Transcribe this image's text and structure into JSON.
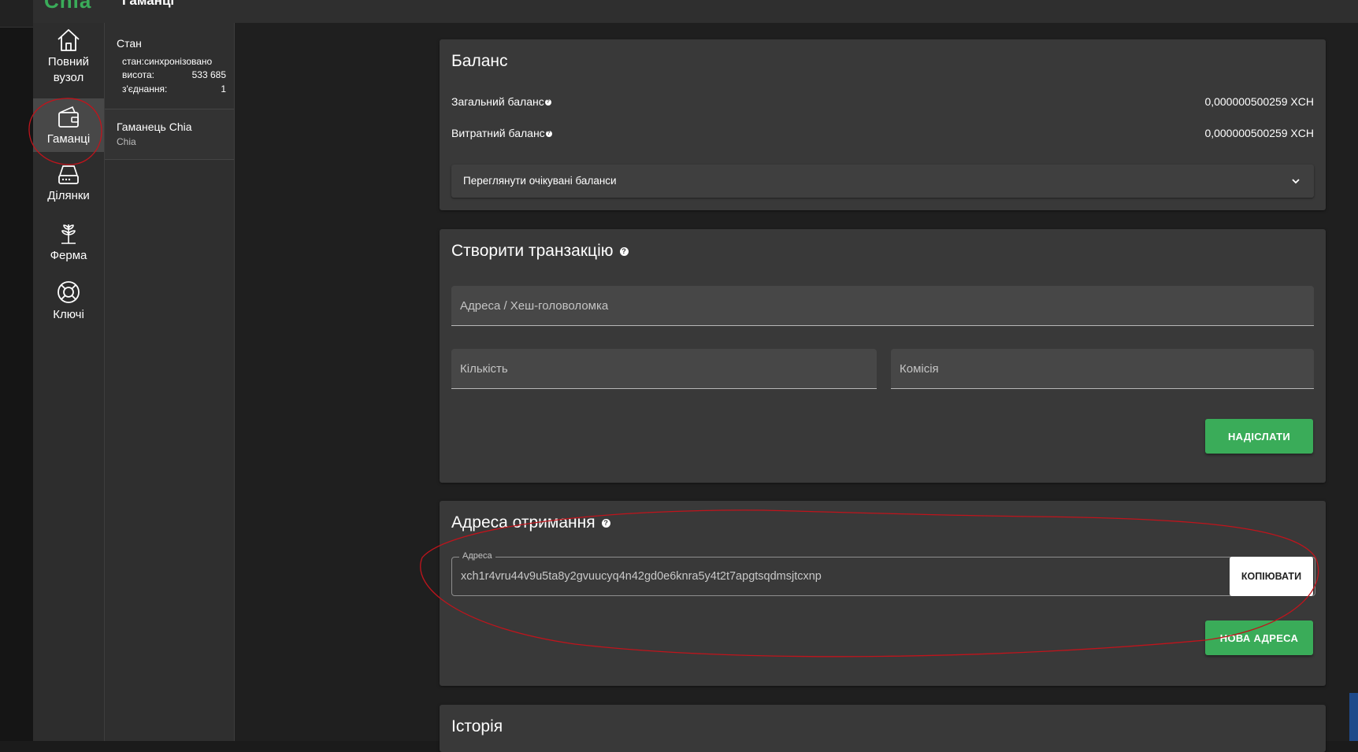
{
  "app": {
    "logo": "Chia",
    "page_title": "Гаманці"
  },
  "nav": {
    "items": [
      {
        "id": "full-node",
        "label_line1": "Повний",
        "label_line2": "вузол",
        "icon": "home-icon"
      },
      {
        "id": "wallets",
        "label": "Гаманці",
        "icon": "wallet-icon",
        "active": true
      },
      {
        "id": "plots",
        "label": "Ділянки",
        "icon": "hard-drive-icon"
      },
      {
        "id": "farm",
        "label": "Ферма",
        "icon": "sprout-icon"
      },
      {
        "id": "keys",
        "label": "Ключі",
        "icon": "lifebuoy-icon"
      }
    ]
  },
  "status": {
    "title": "Стан",
    "rows": [
      {
        "label": "стан:",
        "value": "синхронізовано"
      },
      {
        "label": "висота:",
        "value": "533 685"
      },
      {
        "label": "з'єднання:",
        "value": "1"
      }
    ]
  },
  "wallet": {
    "name": "Гаманець Chia",
    "type": "Chia"
  },
  "balance": {
    "title": "Баланс",
    "total_label": "Загальний баланс",
    "total_value": "0,000000500259 XCH",
    "spendable_label": "Витратний баланс",
    "spendable_value": "0,000000500259 XCH",
    "pending_label": "Переглянути очікувані баланси"
  },
  "transaction": {
    "title": "Створити транзакцію",
    "address_placeholder": "Адреса / Хеш-головоломка",
    "amount_placeholder": "Кількість",
    "fee_placeholder": "Комісія",
    "send_label": "НАДІСЛАТИ"
  },
  "receive": {
    "title": "Адреса отримання",
    "address_legend": "Адреса",
    "address_value": "xch1r4vru44v9u5ta8y2gvuucyq4n42gd0e6knra5y4t2t7apgtsqdmsjtcxnp",
    "copy_label": "КОПІЮВАТИ",
    "new_address_label": "НОВА АДРЕСА"
  },
  "history": {
    "title": "Історія"
  },
  "colors": {
    "accent": "#3aac59",
    "annotation": "#c0141c",
    "card": "#393939"
  }
}
